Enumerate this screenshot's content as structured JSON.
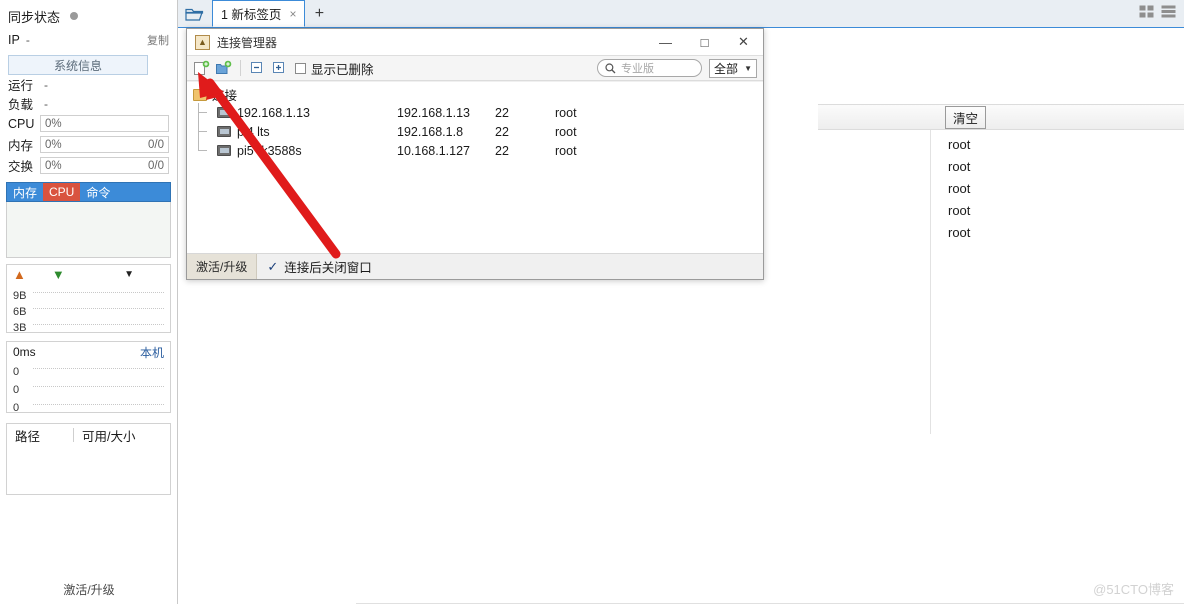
{
  "sidebar": {
    "sync_status_label": "同步状态",
    "ip_label": "IP",
    "ip_value": "-",
    "copy_label": "复制",
    "system_info_button": "系统信息",
    "uptime_label": "运行",
    "uptime_value": "-",
    "load_label": "负载",
    "load_value": "-",
    "cpu_label": "CPU",
    "cpu_value": "0%",
    "mem_label": "内存",
    "mem_value": "0%",
    "mem_detail": "0/0",
    "swap_label": "交换",
    "swap_value": "0%",
    "swap_detail": "0/0",
    "tabs": [
      {
        "label": "内存",
        "highlight": false
      },
      {
        "label": "CPU",
        "highlight": true
      },
      {
        "label": "命令",
        "highlight": false
      }
    ],
    "net_graph": {
      "ticks": [
        "9B",
        "6B",
        "3B"
      ]
    },
    "ping_graph": {
      "latency": "0ms",
      "local_link": "本机",
      "ticks": [
        "0",
        "0",
        "0"
      ]
    },
    "disk": {
      "path_header": "路径",
      "size_header": "可用/大小"
    },
    "footer_button": "激活/升级"
  },
  "tabbar": {
    "folder_icon": "folder-open-icon",
    "tab_label": "1 新标签页",
    "close_icon": "×",
    "new_tab_icon": "+",
    "grid_view_icon": "grid-view-icon",
    "list_view_icon": "list-view-icon"
  },
  "right_panel": {
    "clear_button": "清空",
    "entries": [
      "root",
      "root",
      "root",
      "root",
      "root"
    ]
  },
  "dialog": {
    "title": "连接管理器",
    "window_controls": {
      "minimize": "—",
      "maximize": "□",
      "close": "✕"
    },
    "toolbar": {
      "new_session_icon": "new-session-icon",
      "new_folder_icon": "new-folder-icon",
      "collapse_all_icon": "collapse-all-icon",
      "expand_all_icon": "expand-all-icon",
      "show_deleted_label": "显示已删除",
      "show_deleted_checked": false,
      "search_placeholder": "专业版",
      "search_value": "",
      "filter_value": "全部"
    },
    "tree": {
      "root_label": "连接",
      "rows": [
        {
          "name": "192.168.1.13",
          "host": "192.168.1.13",
          "port": "22",
          "user": "root"
        },
        {
          "name": "pi4 lts",
          "host": "192.168.1.8",
          "port": "22",
          "user": "root"
        },
        {
          "name": "pi5 rk3588s",
          "host": "10.168.1.127",
          "port": "22",
          "user": "root"
        }
      ]
    },
    "footer": {
      "activate_button": "激活/升级",
      "close_after_connect_label": "连接后关闭窗口",
      "close_after_connect_checked": true
    }
  },
  "annotation": {
    "arrow_color": "#e01b1b"
  },
  "watermark": "@51CTO博客"
}
